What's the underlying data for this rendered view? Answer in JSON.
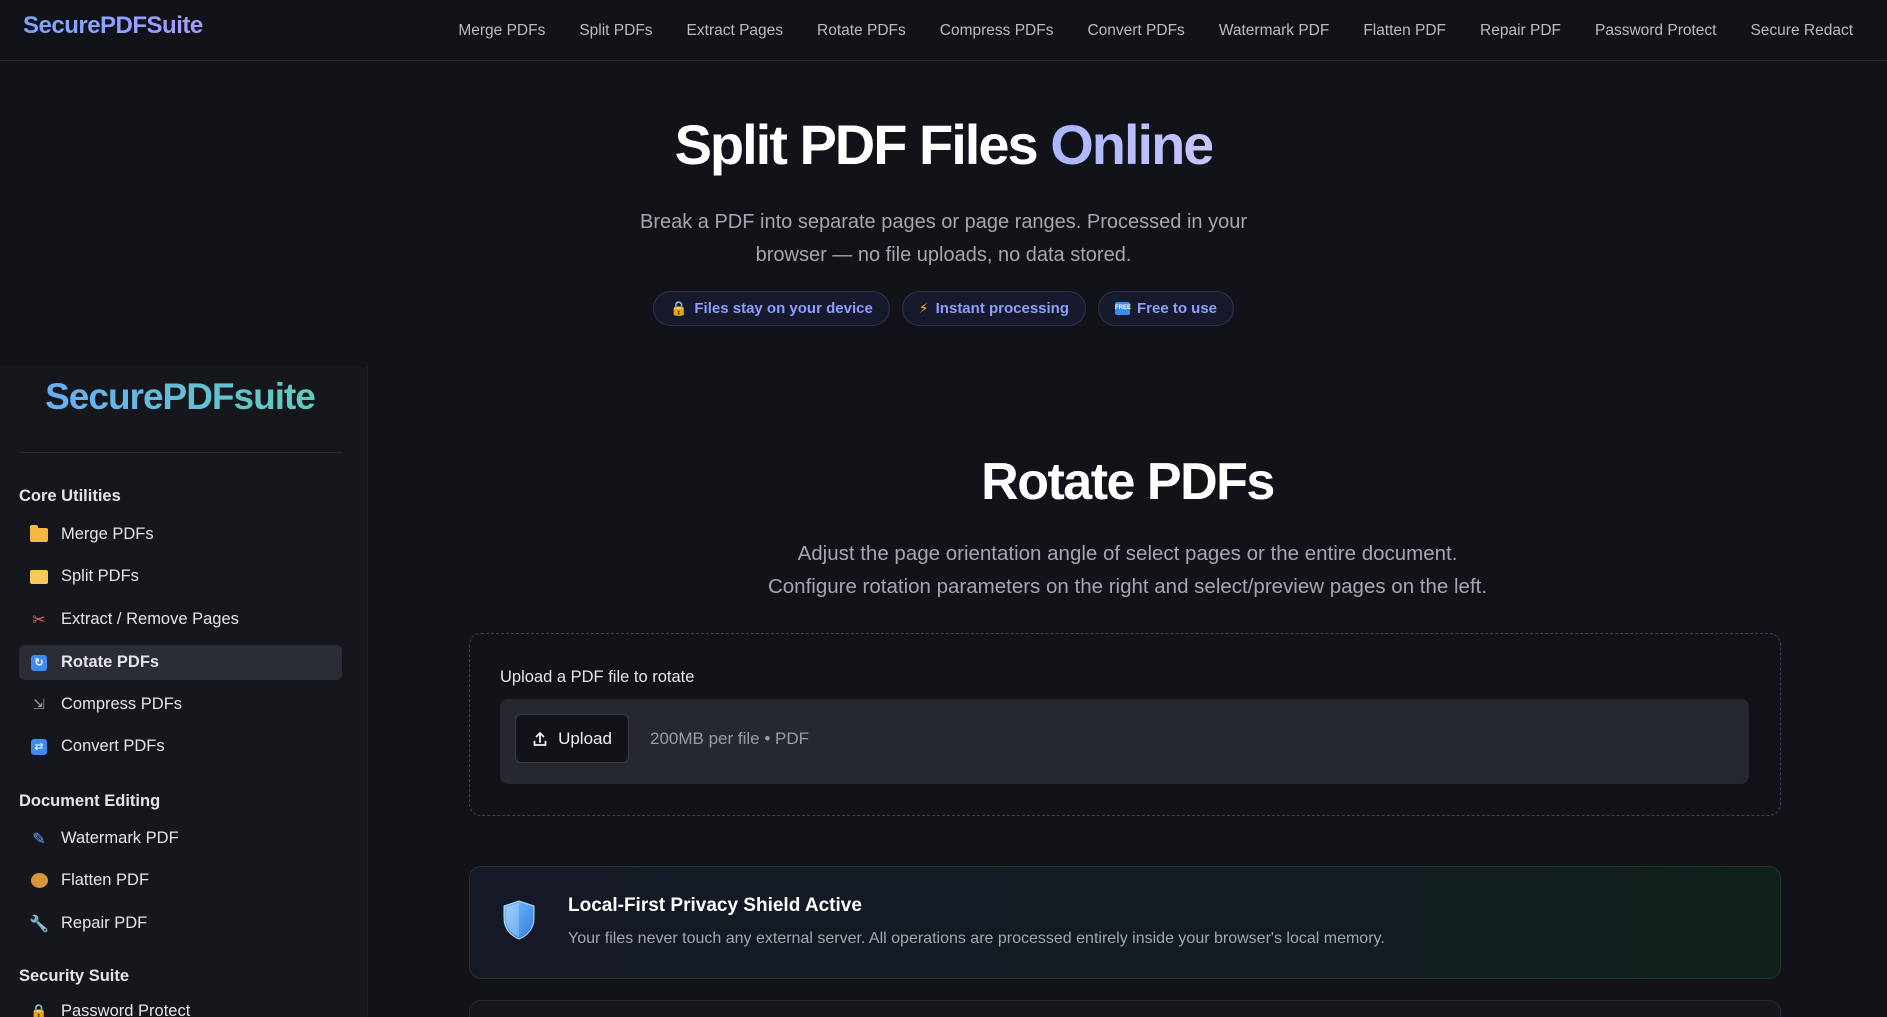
{
  "topnav": {
    "brand": "SecurePDFSuite",
    "links": [
      "Merge PDFs",
      "Split PDFs",
      "Extract Pages",
      "Rotate PDFs",
      "Compress PDFs",
      "Convert PDFs",
      "Watermark PDF",
      "Flatten PDF",
      "Repair PDF",
      "Password Protect",
      "Secure Redact"
    ]
  },
  "hero": {
    "title_main": "Split PDF Files",
    "title_accent": "Online",
    "subtitle": "Break a PDF into separate pages or page ranges. Processed in your browser — no file uploads, no data stored.",
    "badges": [
      {
        "icon": "lock-icon",
        "label": "Files stay on your device"
      },
      {
        "icon": "lightning-icon",
        "label": "Instant processing"
      },
      {
        "icon": "free-icon",
        "label": "Free to use"
      }
    ]
  },
  "sidebar": {
    "brand": "SecurePDFsuite",
    "groups": {
      "core": "Core Utilities",
      "editing": "Document Editing",
      "security": "Security Suite"
    },
    "items": [
      {
        "icon": "folder-icon",
        "label": "Merge PDFs"
      },
      {
        "icon": "open-folder-icon",
        "label": "Split PDFs"
      },
      {
        "icon": "scissors-icon",
        "label": "Extract / Remove Pages"
      },
      {
        "icon": "rotate-icon",
        "label": "Rotate PDFs",
        "active": true
      },
      {
        "icon": "compress-icon",
        "label": "Compress PDFs"
      },
      {
        "icon": "convert-icon",
        "label": "Convert PDFs"
      },
      {
        "icon": "pen-icon",
        "label": "Watermark PDF"
      },
      {
        "icon": "pancake-icon",
        "label": "Flatten PDF"
      },
      {
        "icon": "wrench-icon",
        "label": "Repair PDF"
      },
      {
        "icon": "lock-icon",
        "label": "Password Protect"
      }
    ]
  },
  "main": {
    "title": "Rotate PDFs",
    "desc_line1": "Adjust the page orientation angle of select pages or the entire document.",
    "desc_line2": "Configure rotation parameters on the right and select/preview pages on the left.",
    "upload": {
      "label": "Upload a PDF file to rotate",
      "button": "Upload",
      "hint": "200MB per file • PDF"
    },
    "privacy": {
      "title": "Local-First Privacy Shield Active",
      "text": "Your files never touch any external server. All operations are processed entirely inside your browser's local memory."
    }
  },
  "colors": {
    "background": "#111318",
    "accent_blue": "#8f9dff",
    "sidebar_bg": "#15171d",
    "active_item": "#2a2d36"
  }
}
